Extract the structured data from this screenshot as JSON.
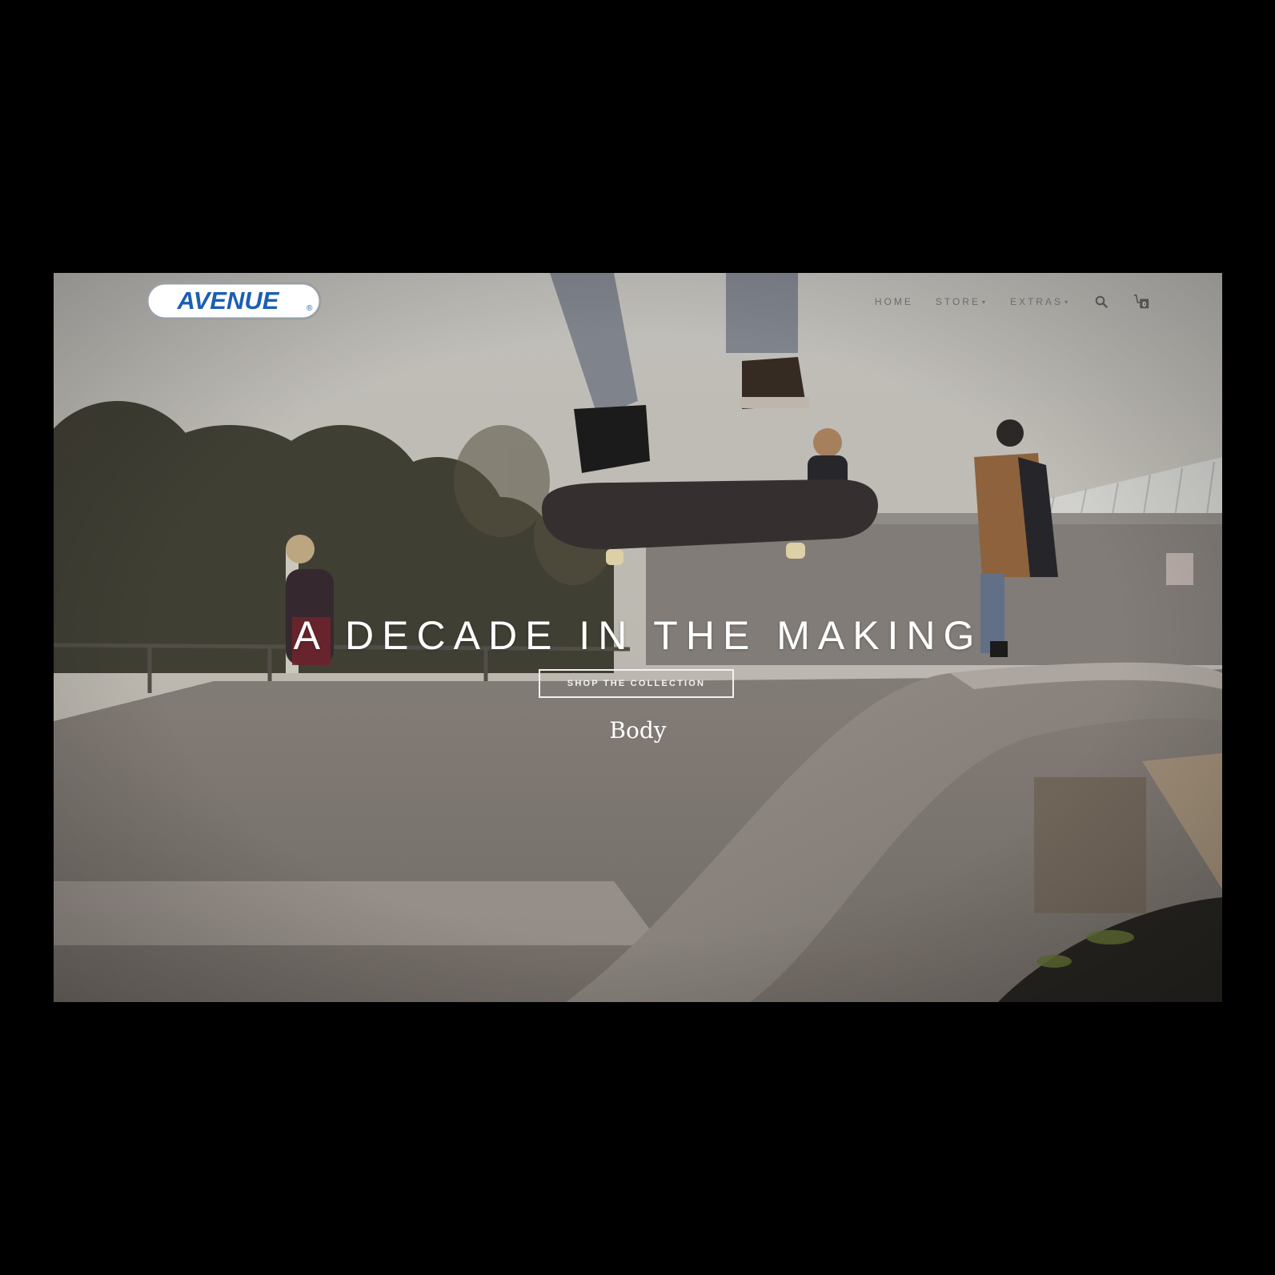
{
  "brand": {
    "logo_text": "AVENUE",
    "logo_mark": "®",
    "logo_color": "#1a5fb4"
  },
  "nav": {
    "items": [
      {
        "label": "HOME",
        "has_dropdown": false
      },
      {
        "label": "STORE",
        "has_dropdown": true
      },
      {
        "label": "EXTRAS",
        "has_dropdown": true
      }
    ],
    "search_icon": "search-icon",
    "cart_icon": "cart-icon",
    "cart_count": "0"
  },
  "hero": {
    "title": "A DECADE IN THE MAKING",
    "cta_label": "SHOP THE COLLECTION",
    "body_label": "Body"
  }
}
